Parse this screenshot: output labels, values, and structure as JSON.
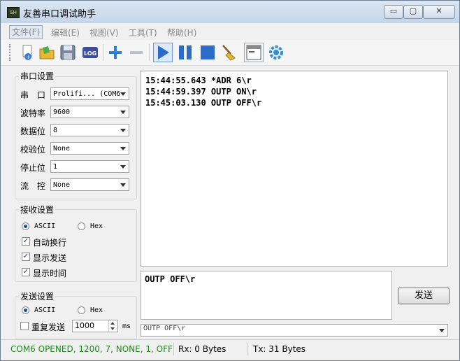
{
  "window": {
    "title": "友善串口调试助手",
    "icon_text": "SH",
    "controls": {
      "minimize": "▭",
      "maximize": "▢",
      "close": "✕"
    }
  },
  "menu": [
    "文件(F)",
    "编辑(E)",
    "视图(V)",
    "工具(T)",
    "帮助(H)"
  ],
  "toolbar": {
    "log_label": "LOG",
    "icons": [
      "new-file-icon",
      "open-folder-icon",
      "save-icon",
      "log-icon",
      "add-icon",
      "remove-icon",
      "play-icon",
      "pause-icon",
      "stop-icon",
      "clear-broom-icon",
      "new-window-icon",
      "settings-gear-icon"
    ]
  },
  "serial_settings": {
    "title": "串口设置",
    "rows": [
      {
        "label": "串　口",
        "value": "Prolifi... (COM6"
      },
      {
        "label": "波特率",
        "value": "9600"
      },
      {
        "label": "数据位",
        "value": "8"
      },
      {
        "label": "校验位",
        "value": "None"
      },
      {
        "label": "停止位",
        "value": "1"
      },
      {
        "label": "流　控",
        "value": "None"
      }
    ]
  },
  "receive_settings": {
    "title": "接收设置",
    "radio_ascii": "ASCII",
    "radio_hex": "Hex",
    "options": [
      "自动换行",
      "显示发送",
      "显示时间"
    ]
  },
  "send_settings": {
    "title": "发送设置",
    "radio_ascii": "ASCII",
    "radio_hex": "Hex",
    "repeat_label": "重复发送",
    "interval_value": "1000",
    "unit": "ms"
  },
  "receive_log": [
    "15:44:55.643 *ADR 6\\r",
    "15:44:59.397 OUTP ON\\r",
    "15:45:03.130 OUTP OFF\\r"
  ],
  "send_text": "OUTP OFF\\r",
  "send_button": "发送",
  "history_value": "OUTP OFF\\r",
  "status": {
    "port_state": "COM6 OPENED, 1200, 7, NONE, 1, OFF",
    "rx": "Rx: 0 Bytes",
    "tx": "Tx: 31 Bytes",
    "port_state_color": "#1a8a1a"
  }
}
